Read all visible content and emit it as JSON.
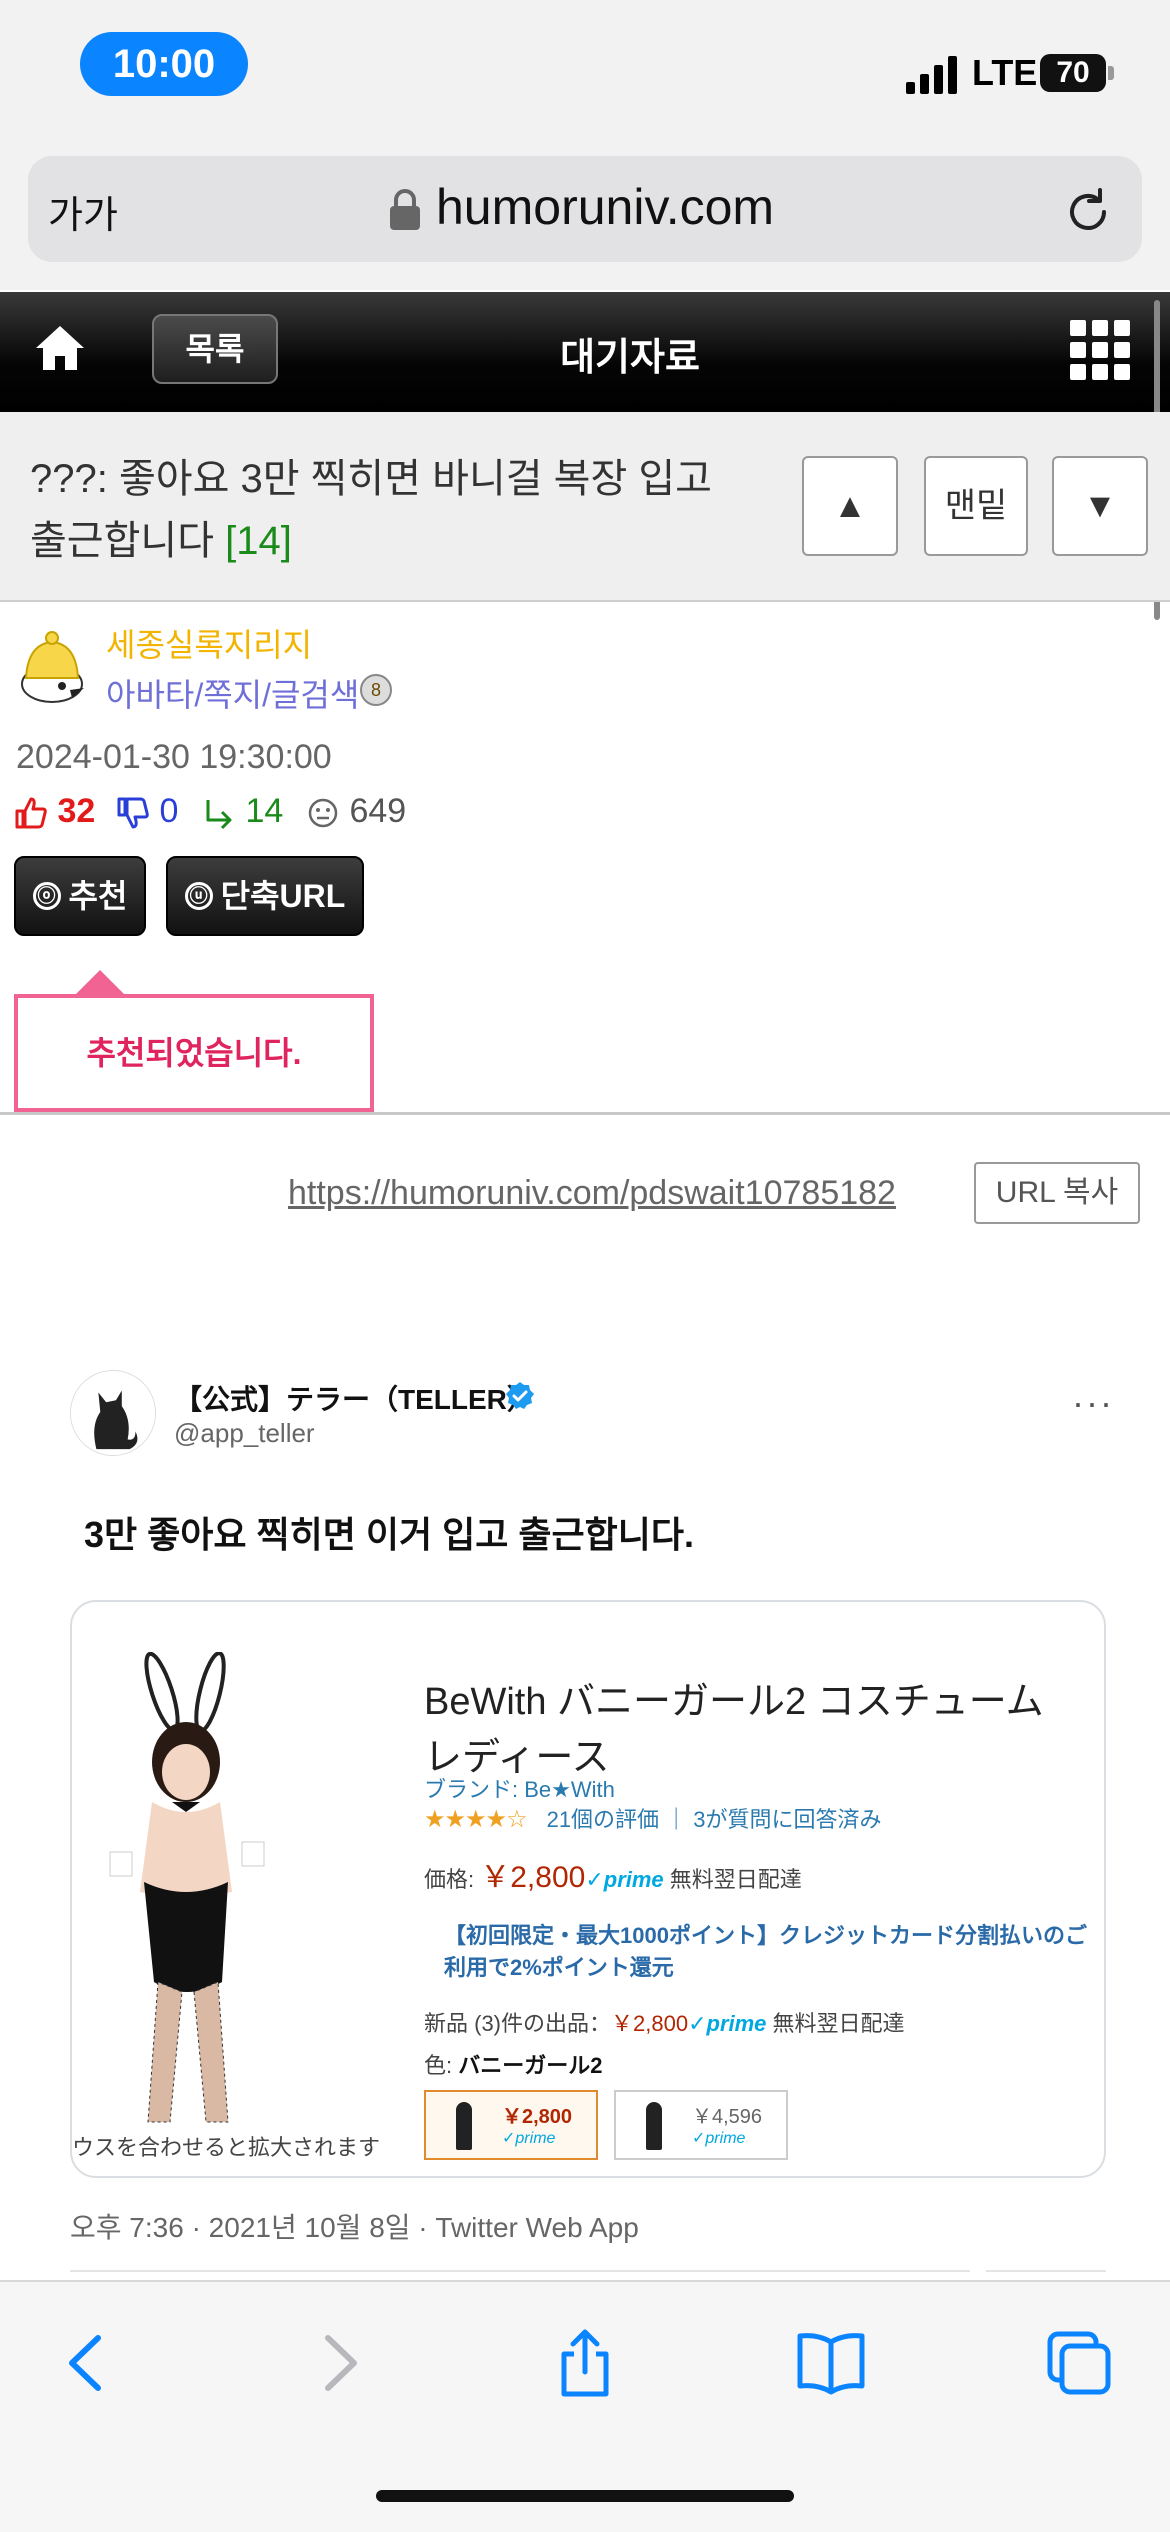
{
  "status_bar": {
    "time": "10:00",
    "network": "LTE",
    "battery": "70"
  },
  "address_bar": {
    "text_size_label": "가가",
    "url": "humoruniv.com"
  },
  "site_header": {
    "list_button": "목록",
    "board_title": "대기자료"
  },
  "post": {
    "title": "???: 좋아요 3만 찍히면 바니걸 복장 입고 출근합니다",
    "comment_count": "[14]",
    "nav": {
      "up": "▲",
      "bottom": "맨밑",
      "down": "▼"
    },
    "author": {
      "name": "세종실록지리지",
      "links": "아바타/쪽지/글검색",
      "badge": "8"
    },
    "date": "2024-01-30 19:30:00",
    "stats": {
      "likes": "32",
      "dislikes": "0",
      "shares": "14",
      "views": "649"
    },
    "buttons": {
      "recommend": "추천",
      "recommend_icon": "ⓞ",
      "short_url": "단축URL",
      "short_url_icon": "ⓤ"
    },
    "tooltip": "추천되었습니다.",
    "permalink": "https://humoruniv.com/pdswait10785182",
    "copy_url_button": "URL 복사"
  },
  "tweet": {
    "display_name": "【公式】テラー（TELLER）",
    "handle": "@app_teller",
    "text": "3만 좋아요 찍히면 이거 입고 출근합니다.",
    "meta": "오후 7:36 · 2021년 10월 8일 · Twitter Web App",
    "more_icon": "···",
    "card": {
      "product_title": "BeWith バニーガール2 コスチューム レディース",
      "brand": "ブランド: Be★With",
      "stars": "★★★★☆",
      "rating_text": "21個の評価 ｜ 3が質問に回答済み",
      "price_label": "価格:",
      "price": "￥2,800",
      "prime": "✓prime",
      "delivery": "無料翌日配達",
      "promo": "【初回限定・最大1000ポイント】クレジットカード分割払いのご利用で2%ポイント還元",
      "new_label": "新品 (3)件の出品：",
      "new_price": "￥2,800",
      "color_label": "色:",
      "color_value": "バニーガール2",
      "variants": [
        {
          "price": "￥2,800",
          "prime": "✓prime"
        },
        {
          "price": "￥4,596",
          "prime": "✓prime"
        }
      ],
      "hover_hint": "ウスを合わせると拡大されます"
    }
  },
  "icons": {
    "home": "home-icon",
    "grid": "grid-menu-icon",
    "lock": "lock-icon",
    "reload": "reload-icon",
    "back": "back-icon",
    "forward": "forward-icon",
    "share": "share-icon",
    "bookmarks": "bookmarks-icon",
    "tabs": "tabs-icon"
  },
  "colors": {
    "accent": "#0a84ff",
    "author": "#f2b400",
    "links": "#6f6fd8",
    "likes": "#e31a1a",
    "dislikes": "#2a3fd8",
    "shares": "#1a8a1a",
    "tooltip": "#e0245e"
  }
}
